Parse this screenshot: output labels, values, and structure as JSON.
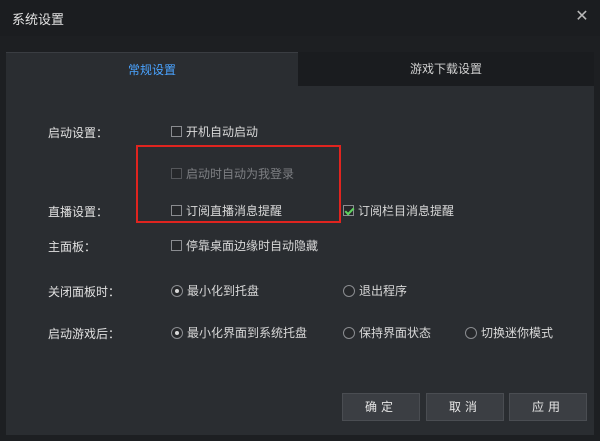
{
  "window": {
    "title": "系统设置",
    "close_glyph": "✕"
  },
  "tabs": [
    {
      "label": "常规设置",
      "active": true
    },
    {
      "label": "游戏下载设置",
      "active": false
    }
  ],
  "sections": {
    "startup": {
      "label": "启动设置：",
      "options": [
        {
          "label": "开机自动启动",
          "checked": false,
          "disabled": false
        },
        {
          "label": "启动时自动为我登录",
          "checked": false,
          "disabled": true
        }
      ]
    },
    "live": {
      "label": "直播设置：",
      "options": [
        {
          "label": "订阅直播消息提醒",
          "checked": false
        },
        {
          "label": "订阅栏目消息提醒",
          "checked": true
        }
      ]
    },
    "mainpanel": {
      "label": "主面板：",
      "options": [
        {
          "label": "停靠桌面边缘时自动隐藏",
          "checked": false
        }
      ]
    },
    "close": {
      "label": "关闭面板时：",
      "options": [
        {
          "label": "最小化到托盘",
          "selected": true
        },
        {
          "label": "退出程序",
          "selected": false
        }
      ]
    },
    "game": {
      "label": "启动游戏后：",
      "options": [
        {
          "label": "最小化界面到系统托盘",
          "selected": true
        },
        {
          "label": "保持界面状态",
          "selected": false
        },
        {
          "label": "切换迷你模式",
          "selected": false
        }
      ]
    }
  },
  "buttons": {
    "ok": "确定",
    "cancel": "取消",
    "apply": "应用"
  },
  "colors": {
    "accent": "#4aa3ff",
    "highlight_box": "#e0241f",
    "check_mark": "#5fd35f"
  }
}
